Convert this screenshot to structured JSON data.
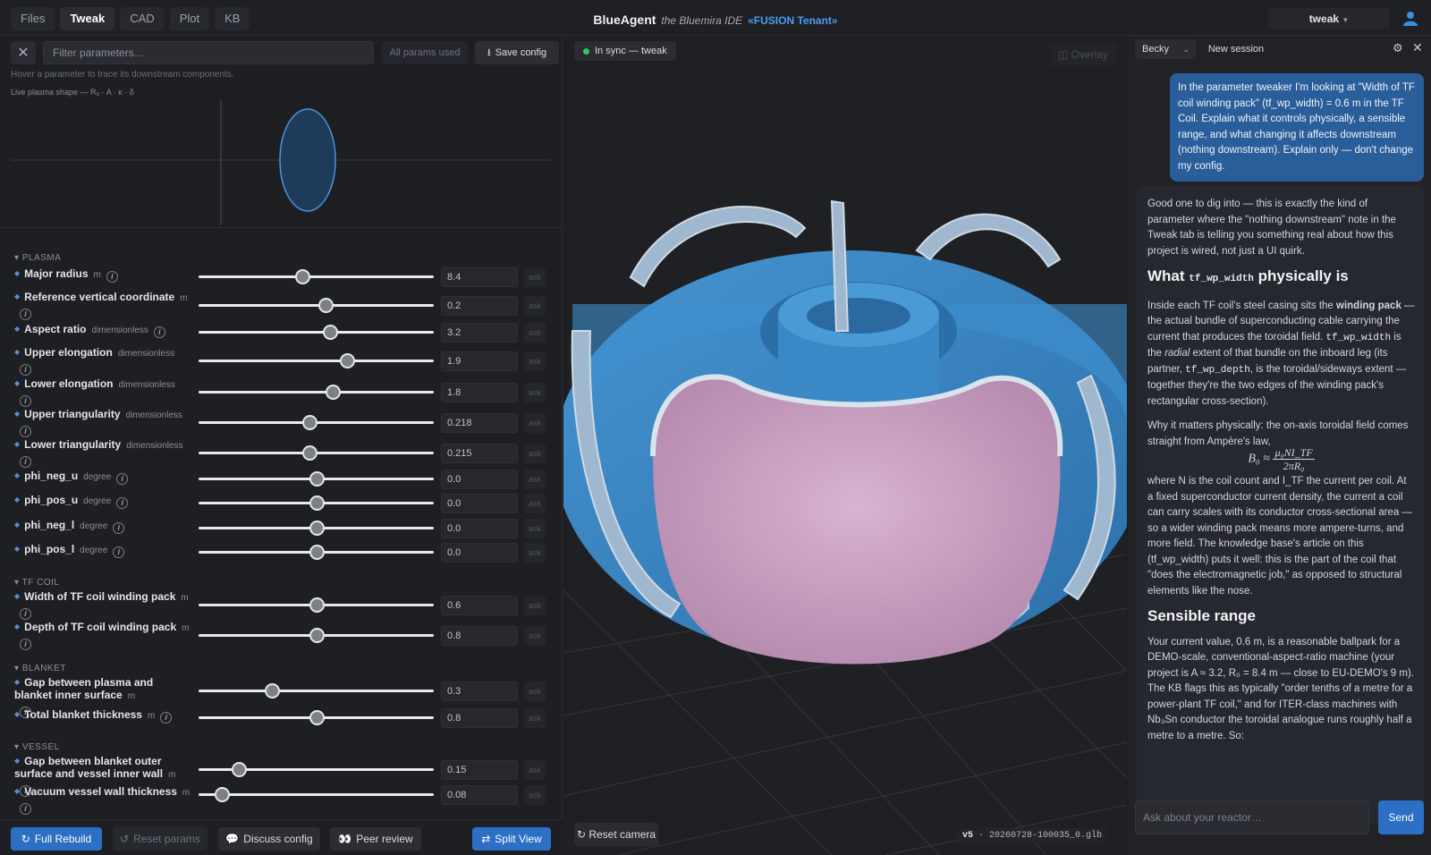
{
  "nav": {
    "tabs": [
      {
        "label": "Files"
      },
      {
        "label": "Tweak"
      },
      {
        "label": "CAD"
      },
      {
        "label": "Plot"
      },
      {
        "label": "KB"
      }
    ],
    "active_tab": "Tweak"
  },
  "brand": {
    "name": "BlueAgent",
    "subtitle": "the Bluemira IDE",
    "tenant": "«FUSION Tenant»"
  },
  "user": {
    "mode": "tweak"
  },
  "tweak": {
    "filter_placeholder": "Filter parameters…",
    "all_params_label": "All params used",
    "save_label": "Save config",
    "hint": "Hover a parameter to trace its downstream components.",
    "plasma_shape_label": "Live plasma shape — R₀ · A · κ · δ",
    "sections": [
      {
        "title": "PLASMA"
      },
      {
        "title": "TF COIL"
      },
      {
        "title": "BLANKET"
      },
      {
        "title": "VESSEL"
      }
    ],
    "ask_label": "ask",
    "params": [
      {
        "label": "Major radius",
        "unit": "m",
        "value": "8.4",
        "slider": 0.44
      },
      {
        "label": "Reference vertical coordinate",
        "unit": "m",
        "value": "0.2",
        "slider": 0.54
      },
      {
        "label": "Aspect ratio",
        "unit": "dimensionless",
        "value": "3.2",
        "slider": 0.56
      },
      {
        "label": "Upper elongation",
        "unit": "dimensionless",
        "value": "1.9",
        "slider": 0.63
      },
      {
        "label": "Lower elongation",
        "unit": "dimensionless",
        "value": "1.8",
        "slider": 0.57
      },
      {
        "label": "Upper triangularity",
        "unit": "dimensionless",
        "value": "0.218",
        "slider": 0.47
      },
      {
        "label": "Lower triangularity",
        "unit": "dimensionless",
        "value": "0.215",
        "slider": 0.47
      },
      {
        "label": "phi_neg_u",
        "unit": "degree",
        "value": "0.0",
        "slider": 0.5
      },
      {
        "label": "phi_pos_u",
        "unit": "degree",
        "value": "0.0",
        "slider": 0.5
      },
      {
        "label": "phi_neg_l",
        "unit": "degree",
        "value": "0.0",
        "slider": 0.5
      },
      {
        "label": "phi_pos_l",
        "unit": "degree",
        "value": "0.0",
        "slider": 0.5
      },
      {
        "label": "Width of TF coil winding pack",
        "unit": "m",
        "value": "0.6",
        "slider": 0.5
      },
      {
        "label": "Depth of TF coil winding pack",
        "unit": "m",
        "value": "0.8",
        "slider": 0.5
      },
      {
        "label": "Gap between plasma and blanket inner surface",
        "unit": "m",
        "value": "0.3",
        "slider": 0.31
      },
      {
        "label": "Total blanket thickness",
        "unit": "m",
        "value": "0.8",
        "slider": 0.5
      },
      {
        "label": "Gap between blanket outer surface and vessel inner wall",
        "unit": "m",
        "value": "0.15",
        "slider": 0.17
      },
      {
        "label": "Vacuum vessel wall thickness",
        "unit": "m",
        "value": "0.08",
        "slider": 0.1
      }
    ],
    "buttons": {
      "full_rebuild": "Full Rebuild",
      "reset_params": "Reset params",
      "discuss_config": "Discuss config",
      "peer_review": "Peer review",
      "split_view": "Split View"
    }
  },
  "viewport": {
    "sync_status": "In sync — tweak",
    "overlay_label": "Overlay",
    "reset_camera": "Reset camera",
    "version_tag": "v5",
    "version_file": "· 20260728-100035_0.glb"
  },
  "chat": {
    "persona": "Becky",
    "new_session": "New session",
    "user_message": "In the parameter tweaker I'm looking at \"Width of TF coil winding pack\" (tf_wp_width) = 0.6 m in the TF Coil. Explain what it controls physically, a sensible range, and what changing it affects downstream (nothing downstream). Explain only — don't change my config.",
    "reply": {
      "intro": "Good one to dig into — this is exactly the kind of parameter where the \"nothing downstream\" note in the Tweak tab is telling you something real about how this project is wired, not just a UI quirk.",
      "h1_pre": "What ",
      "h1_code": "tf_wp_width",
      "h1_post": " physically is",
      "p1_a": "Inside each TF coil's steel casing sits the ",
      "p1_b": "winding pack",
      "p1_c": " — the actual bundle of superconducting cable carrying the current that produces the toroidal field. ",
      "p1_code1": "tf_wp_width",
      "p1_d": " is the ",
      "p1_e": "radial",
      "p1_f": " extent of that bundle on the inboard leg (its partner, ",
      "p1_code2": "tf_wp_depth",
      "p1_g": ", is the toroidal/sideways extent — together they're the two edges of the winding pack's rectangular cross-section).",
      "p2": "Why it matters physically: the on-axis toroidal field comes straight from Ampère's law,",
      "eq_lhs": "B₀ ≈",
      "eq_num": "μ₀NI_TF",
      "eq_den": "2πR₀",
      "p3": "where N is the coil count and I_TF the current per coil. At a fixed superconductor current density, the current a coil can carry scales with its conductor cross-sectional area — so a wider winding pack means more ampere-turns, and more field. The knowledge base's article on this (tf_wp_width) puts it well: this is the part of the coil that \"does the electromagnetic job,\" as opposed to structural elements like the nose.",
      "h2": "Sensible range",
      "p4": "Your current value, 0.6 m, is a reasonable ballpark for a DEMO-scale, conventional-aspect-ratio machine (your project is A ≈ 3.2, R₀ = 8.4 m — close to EU-DEMO's 9 m). The KB flags this as typically \"order tenths of a metre for a power-plant TF coil,\" and for ITER-class machines with Nb₃Sn conductor the toroidal analogue runs roughly half a metre to a metre. So:"
    },
    "input_placeholder": "Ask about your reactor…",
    "send_label": "Send"
  },
  "colors": {
    "accent": "#2d6fc4",
    "coil": "#3b86c6",
    "plasma": "#c9a2c5",
    "sync_ok": "#33c46a"
  }
}
